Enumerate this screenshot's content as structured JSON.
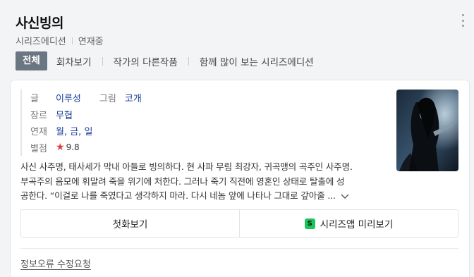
{
  "header": {
    "title": "사신빙의",
    "category": "시리즈에디션",
    "status": "연재중",
    "more_icon": "more-vertical-icon"
  },
  "tabs": [
    {
      "label": "전체",
      "active": true
    },
    {
      "label": "회차보기",
      "active": false
    },
    {
      "label": "작가의 다른작품",
      "active": false
    },
    {
      "label": "함께 많이 보는 시리즈에디션",
      "active": false
    }
  ],
  "info": {
    "writer_label": "글",
    "writer": "이루성",
    "artist_label": "그림",
    "artist": "코개",
    "genre_label": "장르",
    "genre": "무협",
    "schedule_label": "연재",
    "schedule": "월, 금, 일",
    "rating_label": "별점",
    "rating_icon": "star-icon",
    "rating": "9.8"
  },
  "synopsis": {
    "line1": "사신 사주명, 태사세가 막내 아들로 빙의하다. 현 사파 무림 최강자, 귀곡맹의 곡주인 사주명.",
    "line2": "부곡주의 음모에 휘말려 죽을 위기에 처한다. 그러나 죽기 직전에 영혼인 상태로 탈출에 성",
    "line3": "공한다. “이걸로 나를 죽였다고 생각하지 마라. 다시 네놈 앞에 나타나 그대로 갚아줄 ...",
    "expand_icon": "chevron-down-icon"
  },
  "actions": {
    "first_episode": "첫화보기",
    "app_preview": "시리즈앱 미리보기",
    "app_icon": "series-app-icon",
    "app_icon_letter": "S"
  },
  "footer": {
    "report": "정보오류 수정요청"
  },
  "colors": {
    "active_tab_bg": "#6b7683",
    "link_blue": "#1a3f9a",
    "star_red": "#e03c3c",
    "app_green": "#1cc55a"
  }
}
